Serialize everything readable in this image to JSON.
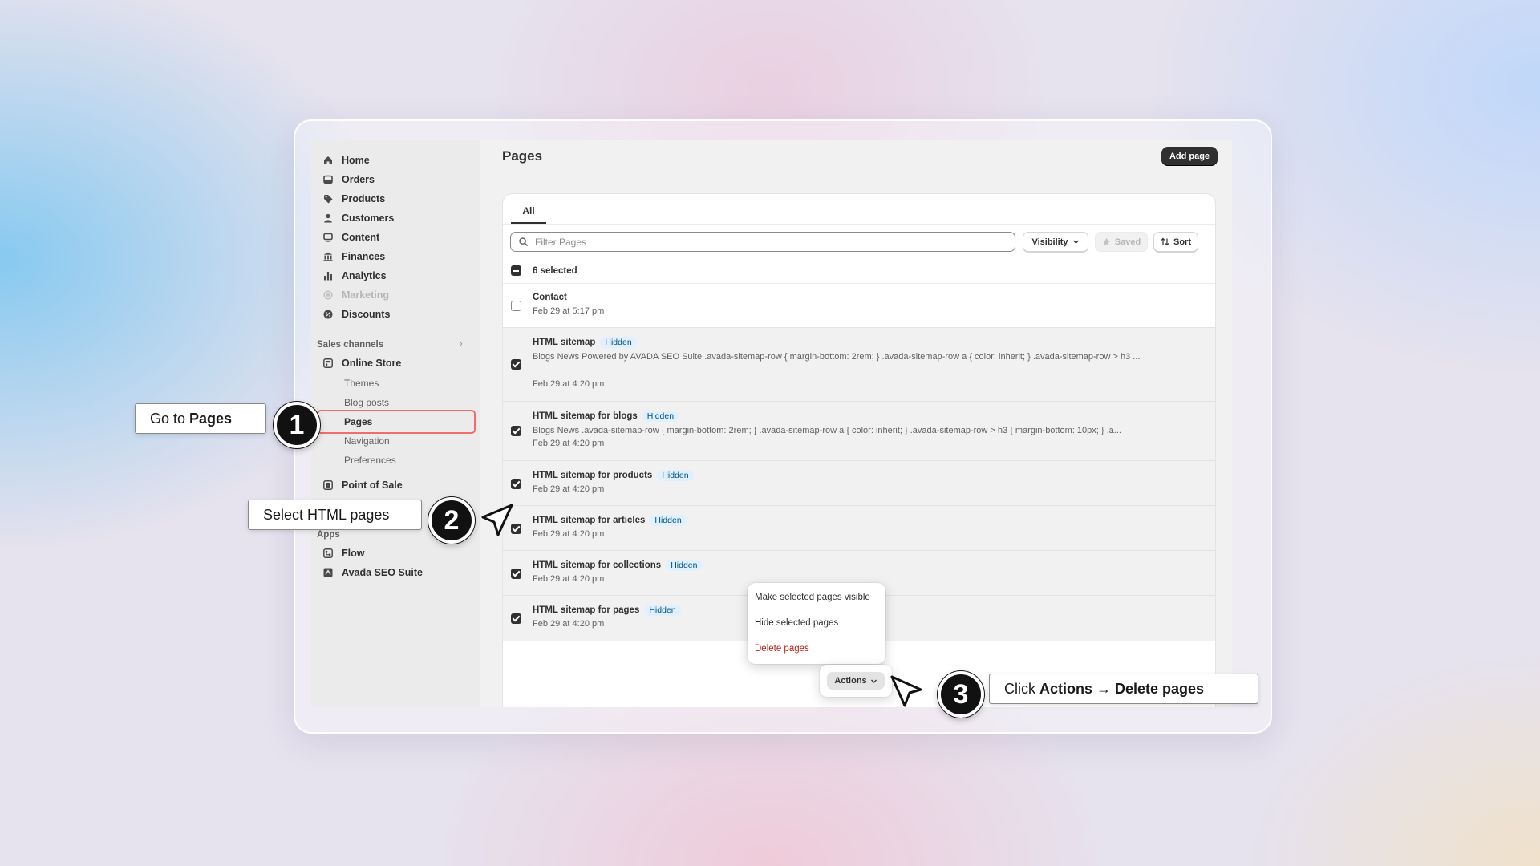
{
  "sidebar": {
    "items": [
      {
        "label": "Home",
        "icon": "home-icon"
      },
      {
        "label": "Orders",
        "icon": "inbox-icon"
      },
      {
        "label": "Products",
        "icon": "tag-icon"
      },
      {
        "label": "Customers",
        "icon": "person-icon"
      },
      {
        "label": "Content",
        "icon": "content-icon"
      },
      {
        "label": "Finances",
        "icon": "bank-icon"
      },
      {
        "label": "Analytics",
        "icon": "bar-chart-icon"
      },
      {
        "label": "Marketing",
        "icon": "target-icon"
      },
      {
        "label": "Discounts",
        "icon": "discount-icon"
      }
    ],
    "sales_channels_label": "Sales channels",
    "online_store": "Online Store",
    "online_store_sub": [
      "Themes",
      "Blog posts",
      "Pages",
      "Navigation",
      "Preferences"
    ],
    "point_of_sale": "Point of Sale",
    "apps_label": "Apps",
    "apps": [
      "Flow",
      "Avada SEO Suite"
    ]
  },
  "main": {
    "title": "Pages",
    "add_page_label": "Add page",
    "tab_all": "All",
    "filter_placeholder": "Filter Pages",
    "visibility_label": "Visibility",
    "saved_label": "Saved",
    "sort_label": "Sort",
    "selected_count": "6 selected",
    "hidden_badge": "Hidden",
    "rows": [
      {
        "title": "Contact",
        "date": "Feb 29 at 5:17 pm",
        "selected": false
      },
      {
        "title": "HTML sitemap",
        "desc": "Blogs News Powered by AVADA SEO Suite .avada-sitemap-row { margin-bottom: 2rem; } .avada-sitemap-row a { color: inherit; } .avada-sitemap-row > h3 ...",
        "date": "Feb 29 at 4:20 pm",
        "selected": true
      },
      {
        "title": "HTML sitemap for blogs",
        "desc": "Blogs News .avada-sitemap-row { margin-bottom: 2rem; } .avada-sitemap-row a { color: inherit; } .avada-sitemap-row > h3 { margin-bottom: 10px; } .a...",
        "date": "Feb 29 at 4:20 pm",
        "selected": true
      },
      {
        "title": "HTML sitemap for products",
        "date": "Feb 29 at 4:20 pm",
        "selected": true
      },
      {
        "title": "HTML sitemap for articles",
        "date": "Feb 29 at 4:20 pm",
        "selected": true
      },
      {
        "title": "HTML sitemap for collections",
        "date": "Feb 29 at 4:20 pm",
        "selected": true
      },
      {
        "title": "HTML sitemap for pages",
        "date": "Feb 29 at 4:20 pm",
        "selected": true
      }
    ]
  },
  "actions": {
    "button_label": "Actions",
    "menu": [
      "Make selected pages visible",
      "Hide selected pages",
      "Delete pages"
    ]
  },
  "annotations": {
    "step1_prefix": "Go to ",
    "step1_bold": "Pages",
    "step1_number": "1",
    "step2_text": "Select HTML pages",
    "step2_number": "2",
    "step3_prefix": "Click ",
    "step3_bold": "Actions → Delete pages",
    "step3_number": "3"
  },
  "colors": {
    "highlight": "#ef6d6d",
    "hidden_badge_bg": "#e0f0ff",
    "critical": "#b42318"
  }
}
